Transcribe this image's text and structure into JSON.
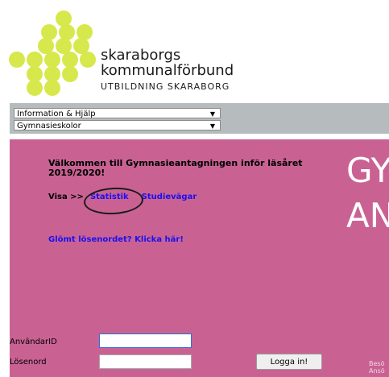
{
  "logo": {
    "name_line1": "skaraborgs",
    "name_line2": "kommunalförbund",
    "subtitle": "UTBILDNING SKARABORG",
    "dot_color": "#d7e84c"
  },
  "nav": {
    "select1": "Information & Hjälp",
    "select2": "Gymnasieskolor",
    "bar_color": "#b6bcbd"
  },
  "main": {
    "bg_color": "#c96293",
    "welcome": "Välkommen till Gymnasieantagningen inför läsåret 2019/2020!",
    "visa_label": "Visa >>",
    "link_statistik": "Statistik",
    "link_studievagar": "Studievägar",
    "forgot_link": "Glömt lösenordet? Klicka här!",
    "big_line1": "GY",
    "big_line2": "AN",
    "link_color": "#1a10ee"
  },
  "login": {
    "user_label": "AnvändarID",
    "pass_label": "Lösenord",
    "user_value": "",
    "pass_value": "",
    "button_label": "Logga in!"
  },
  "footer": {
    "line1": "Besö",
    "line2": "Ansö"
  }
}
